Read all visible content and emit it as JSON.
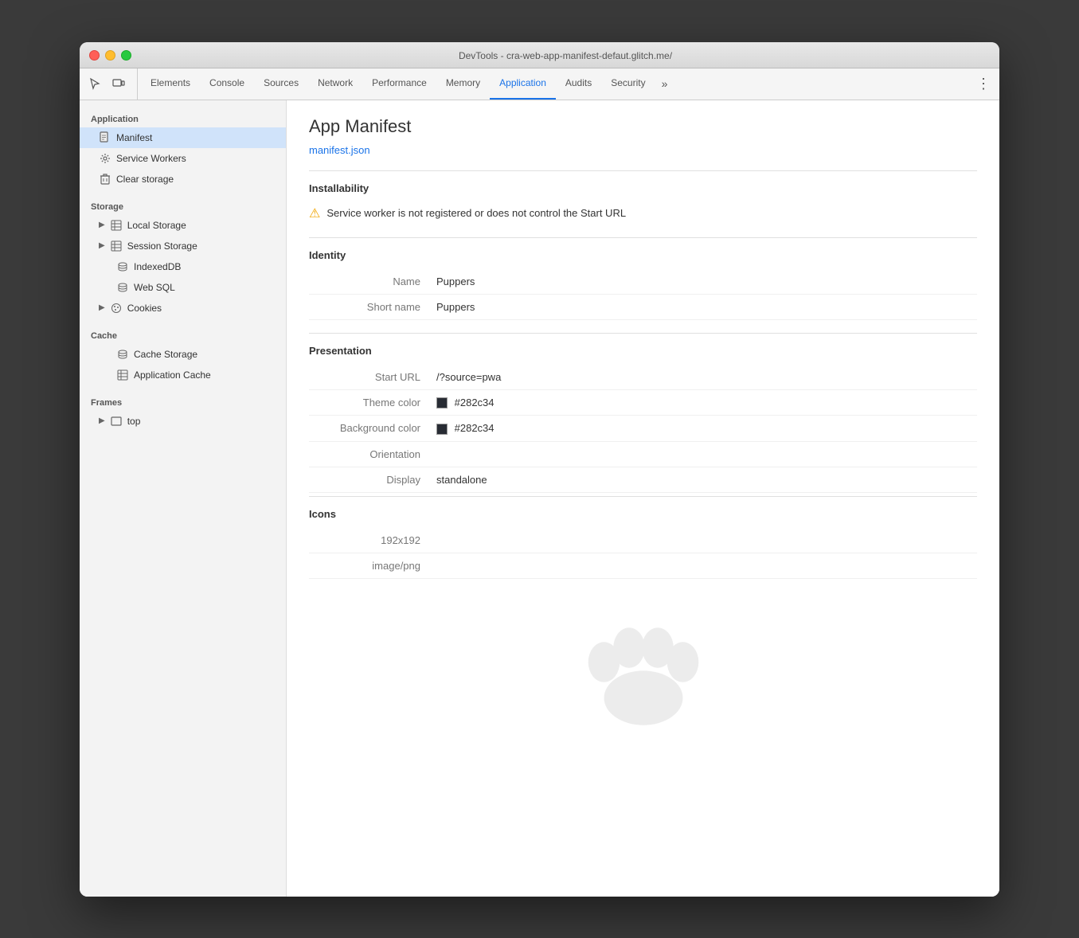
{
  "window": {
    "title": "DevTools - cra-web-app-manifest-defaut.glitch.me/"
  },
  "toolbar": {
    "icons": [
      {
        "name": "cursor-icon",
        "symbol": "⬚"
      },
      {
        "name": "device-icon",
        "symbol": "▭"
      }
    ],
    "tabs": [
      {
        "id": "elements",
        "label": "Elements",
        "active": false
      },
      {
        "id": "console",
        "label": "Console",
        "active": false
      },
      {
        "id": "sources",
        "label": "Sources",
        "active": false
      },
      {
        "id": "network",
        "label": "Network",
        "active": false
      },
      {
        "id": "performance",
        "label": "Performance",
        "active": false
      },
      {
        "id": "memory",
        "label": "Memory",
        "active": false
      },
      {
        "id": "application",
        "label": "Application",
        "active": true
      },
      {
        "id": "audits",
        "label": "Audits",
        "active": false
      },
      {
        "id": "security",
        "label": "Security",
        "active": false
      }
    ],
    "more_tabs_symbol": "»",
    "menu_symbol": "⋮"
  },
  "sidebar": {
    "app_section_title": "Application",
    "app_items": [
      {
        "id": "manifest",
        "label": "Manifest",
        "icon": "📄",
        "active": true
      },
      {
        "id": "service-workers",
        "label": "Service Workers",
        "icon": "⚙️",
        "active": false
      },
      {
        "id": "clear-storage",
        "label": "Clear storage",
        "icon": "🗑️",
        "active": false
      }
    ],
    "storage_section_title": "Storage",
    "storage_items": [
      {
        "id": "local-storage",
        "label": "Local Storage",
        "icon": "▦",
        "expandable": true
      },
      {
        "id": "session-storage",
        "label": "Session Storage",
        "icon": "▦",
        "expandable": true
      },
      {
        "id": "indexeddb",
        "label": "IndexedDB",
        "icon": "🗄",
        "expandable": false
      },
      {
        "id": "web-sql",
        "label": "Web SQL",
        "icon": "🗄",
        "expandable": false
      },
      {
        "id": "cookies",
        "label": "Cookies",
        "icon": "🍪",
        "expandable": true
      }
    ],
    "cache_section_title": "Cache",
    "cache_items": [
      {
        "id": "cache-storage",
        "label": "Cache Storage",
        "icon": "🗄",
        "expandable": false
      },
      {
        "id": "application-cache",
        "label": "Application Cache",
        "icon": "▦",
        "expandable": false
      }
    ],
    "frames_section_title": "Frames",
    "frames_items": [
      {
        "id": "top",
        "label": "top",
        "icon": "▭",
        "expandable": true
      }
    ]
  },
  "content": {
    "title": "App Manifest",
    "manifest_link": "manifest.json",
    "installability_title": "Installability",
    "installability_warning_icon": "⚠",
    "installability_warning": "Service worker is not registered or does not control the Start URL",
    "identity_title": "Identity",
    "identity_properties": [
      {
        "label": "Name",
        "value": "Puppers"
      },
      {
        "label": "Short name",
        "value": "Puppers"
      }
    ],
    "presentation_title": "Presentation",
    "start_url_label": "Start URL",
    "start_url_value": "/?source=pwa",
    "theme_color_label": "Theme color",
    "theme_color_hex": "#282c34",
    "theme_color_display": "#282c34",
    "bg_color_label": "Background color",
    "bg_color_hex": "#282c34",
    "bg_color_display": "#282c34",
    "orientation_label": "Orientation",
    "orientation_value": "",
    "display_label": "Display",
    "display_value": "standalone",
    "icons_title": "Icons",
    "icon_size": "192x192",
    "icon_type": "image/png"
  }
}
